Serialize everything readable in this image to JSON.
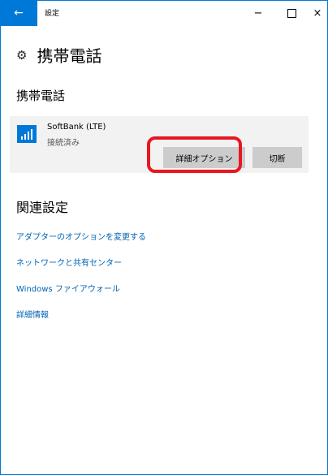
{
  "window": {
    "title": "設定",
    "back_icon": "←",
    "minimize_icon": "−",
    "close_icon": "×"
  },
  "page": {
    "title": "携帯電話",
    "icon": "gear-icon"
  },
  "cellular": {
    "section_title": "携帯電話",
    "network_name": "SoftBank (LTE)",
    "status": "接続済み",
    "advanced_button": "詳細オプション",
    "disconnect_button": "切断"
  },
  "related": {
    "section_title": "関連設定",
    "links": [
      "アダプターのオプションを変更する",
      "ネットワークと共有センター",
      "Windows ファイアウォール",
      "詳細情報"
    ]
  },
  "colors": {
    "accent": "#0078d7",
    "link": "#0063b1",
    "highlight": "#e8171f"
  }
}
